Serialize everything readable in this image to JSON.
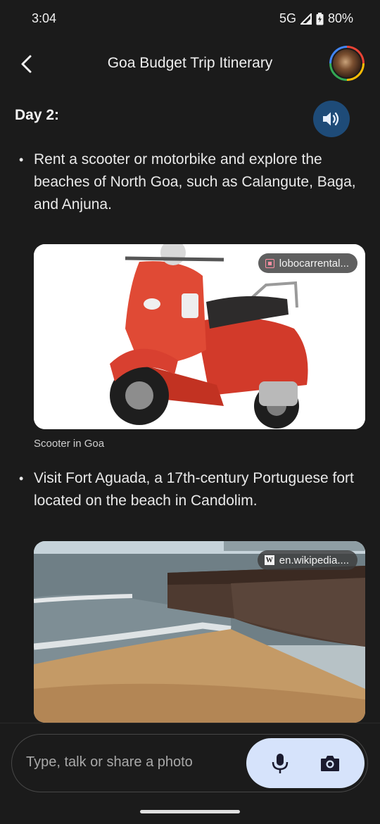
{
  "status": {
    "time": "3:04",
    "network": "5G",
    "battery": "80%"
  },
  "appbar": {
    "title": "Goa Budget Trip Itinerary"
  },
  "content": {
    "day_heading": "Day 2:",
    "bullets": [
      {
        "text": "Rent a scooter or motorbike and explore the beaches of North Goa, such as Calangute, Baga, and Anjuna."
      },
      {
        "text": "Visit Fort Aguada, a 17th-century Portuguese fort located on the beach in Candolim."
      }
    ],
    "images": [
      {
        "source": "lobocarrental...",
        "caption": "Scooter in Goa"
      },
      {
        "source": "en.wikipedia...."
      }
    ]
  },
  "composer": {
    "placeholder": "Type, talk or share a photo"
  },
  "colors": {
    "background": "#1b1b1b",
    "accent": "#1e4b78",
    "action_pill": "#d6e3fb"
  }
}
